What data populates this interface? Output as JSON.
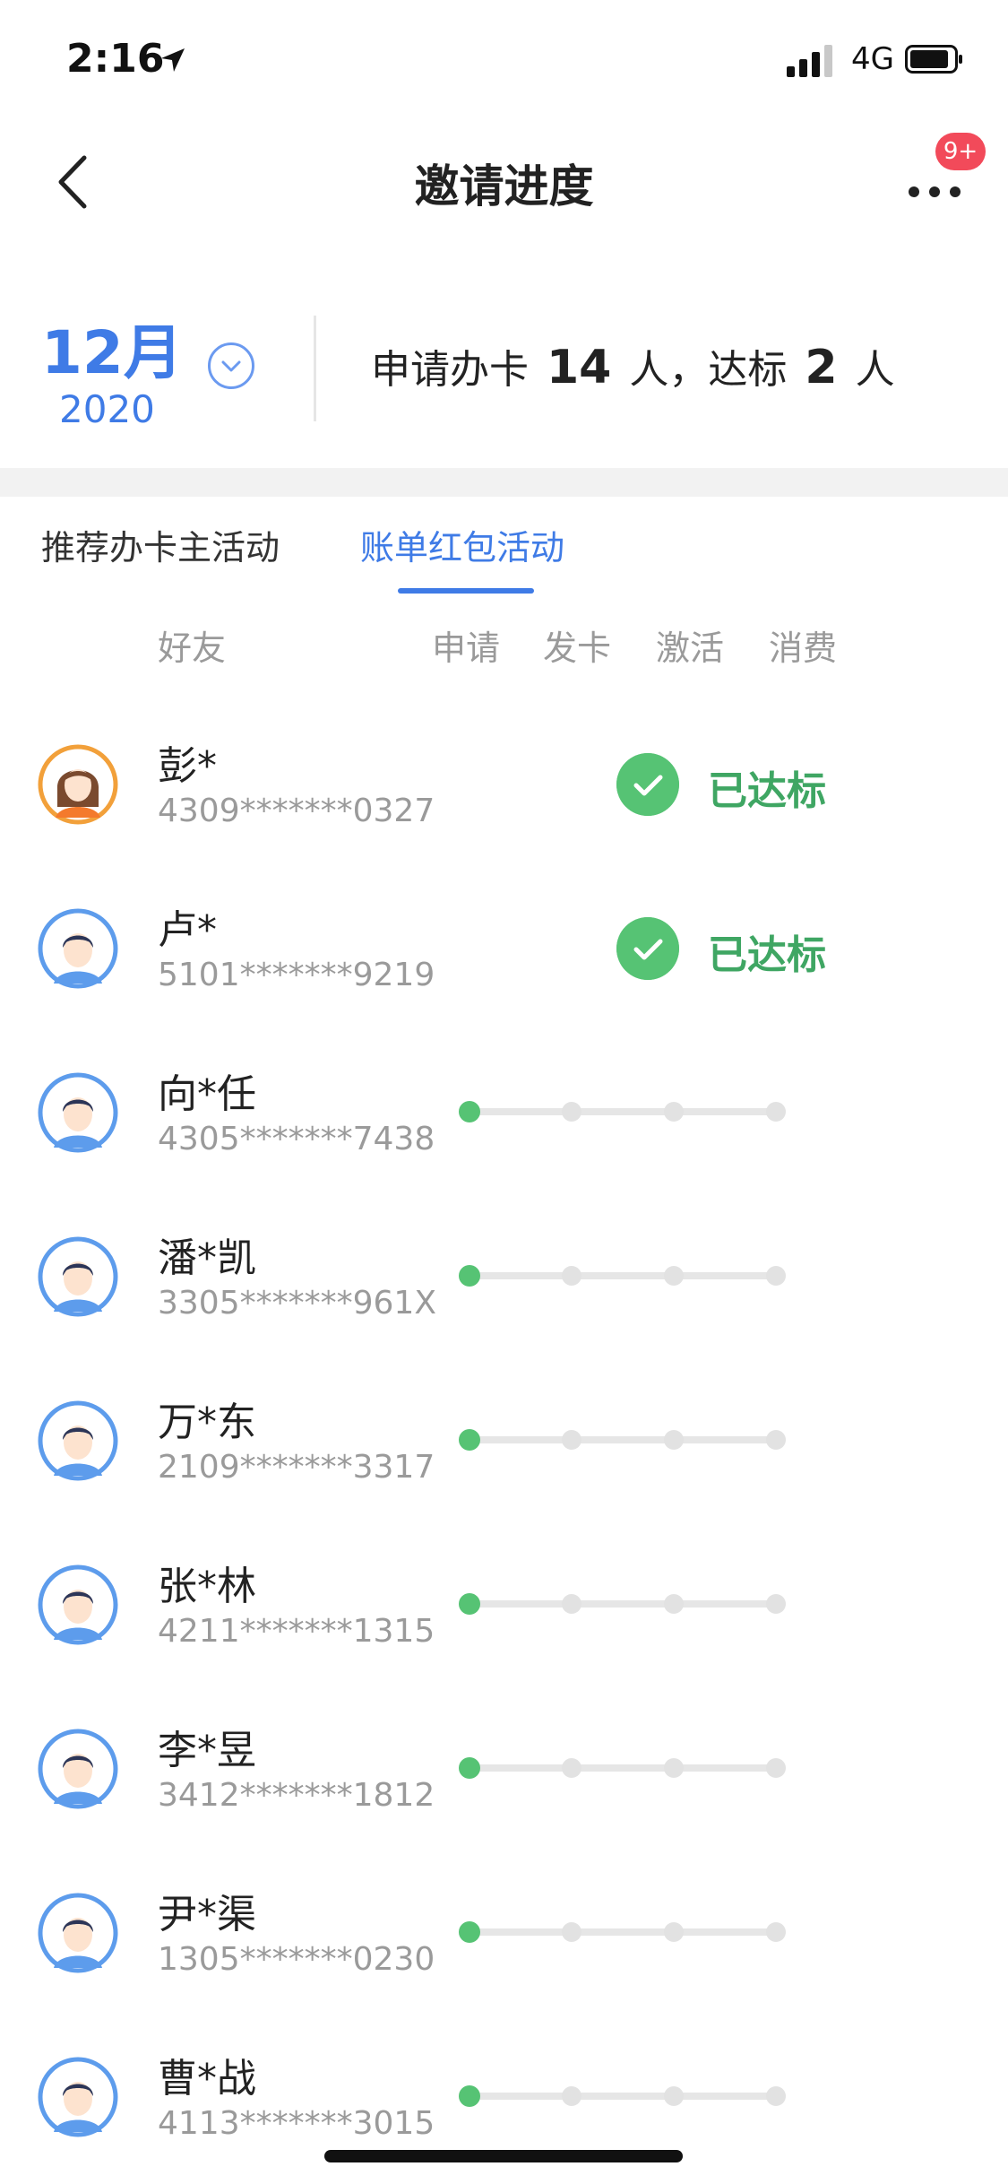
{
  "status_bar": {
    "time": "2:16",
    "network": "4G"
  },
  "nav": {
    "title": "邀请进度",
    "badge": "9+"
  },
  "summary": {
    "month": "12月",
    "year": "2020",
    "applied_prefix": "申请办卡",
    "applied_count": "14",
    "applied_unit": "人，达标",
    "qualified_count": "2",
    "qualified_unit": "人"
  },
  "tabs": [
    {
      "label": "推荐办卡主活动",
      "active": false
    },
    {
      "label": "账单红包活动",
      "active": true
    }
  ],
  "columns": {
    "friend": "好友",
    "apply": "申请",
    "issue": "发卡",
    "activate": "激活",
    "spend": "消费"
  },
  "colors": {
    "accent": "#3f7be6",
    "success": "#56c374",
    "success_text": "#3fa663",
    "badge": "#f24a5a"
  },
  "rows": [
    {
      "name": "彭*",
      "id": "4309*******0327",
      "avatar": "female-avatar-icon",
      "status": "已达标",
      "steps_done": 4
    },
    {
      "name": "卢*",
      "id": "5101*******9219",
      "avatar": "male-avatar-icon",
      "status": "已达标",
      "steps_done": 4
    },
    {
      "name": "向*任",
      "id": "4305*******7438",
      "avatar": "male-avatar-icon",
      "status": "",
      "steps_done": 1
    },
    {
      "name": "潘*凯",
      "id": "3305*******961X",
      "avatar": "male-avatar-icon",
      "status": "",
      "steps_done": 1
    },
    {
      "name": "万*东",
      "id": "2109*******3317",
      "avatar": "male-avatar-icon",
      "status": "",
      "steps_done": 1
    },
    {
      "name": "张*林",
      "id": "4211*******1315",
      "avatar": "male-avatar-icon",
      "status": "",
      "steps_done": 1
    },
    {
      "name": "李*昱",
      "id": "3412*******1812",
      "avatar": "male-avatar-icon",
      "status": "",
      "steps_done": 1
    },
    {
      "name": "尹*渠",
      "id": "1305*******0230",
      "avatar": "male-avatar-icon",
      "status": "",
      "steps_done": 1
    },
    {
      "name": "曹*战",
      "id": "4113*******3015",
      "avatar": "male-avatar-icon",
      "status": "",
      "steps_done": 1
    }
  ]
}
